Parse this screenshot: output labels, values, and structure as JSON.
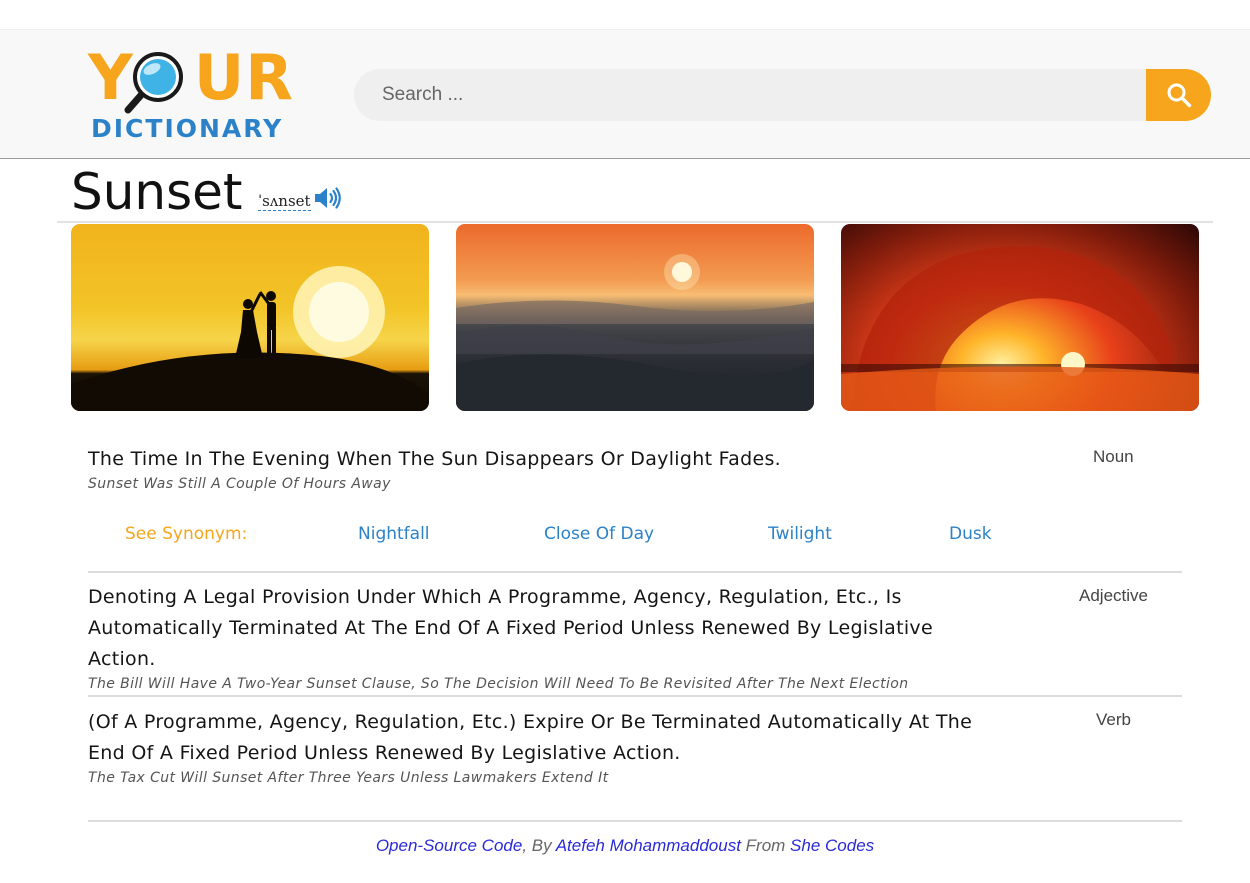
{
  "header": {
    "logo": {
      "line1": "YOUR",
      "line2": "DICTIONARY"
    },
    "search": {
      "placeholder": "Search ...",
      "value": ""
    },
    "search_button_icon": "search-icon"
  },
  "entry": {
    "word": "Sunset",
    "phonetic": "ˈsʌnset",
    "audio_icon": "speaker-icon",
    "images": [
      {
        "subject": "couple silhouette at sunset"
      },
      {
        "subject": "sun over ocean waves"
      },
      {
        "subject": "fiery ocean wave curl"
      }
    ],
    "definitions": [
      {
        "text": "The Time In The Evening When The Sun Disappears Or Daylight Fades.",
        "example": "Sunset Was Still A Couple Of Hours Away",
        "part_of_speech": "Noun"
      },
      {
        "text": "Denoting A Legal Provision Under Which A Programme, Agency, Regulation, Etc., Is Automatically Terminated At The End Of A Fixed Period Unless Renewed By Legislative Action.",
        "example": "The Bill Will Have A Two-Year Sunset Clause, So The Decision Will Need To Be Revisited After The Next Election",
        "part_of_speech": "Adjective"
      },
      {
        "text": "(Of A Programme, Agency, Regulation, Etc.) Expire Or Be Terminated Automatically At The End Of A Fixed Period Unless Renewed By Legislative Action.",
        "example": "The Tax Cut Will Sunset After Three Years Unless Lawmakers Extend It",
        "part_of_speech": "Verb"
      }
    ],
    "synonyms": {
      "label": "See Synonym:",
      "items": [
        "Nightfall",
        "Close Of Day",
        "Twilight",
        "Dusk"
      ]
    }
  },
  "footer": {
    "code_link": "Open-Source Code",
    "by_text": ", By ",
    "author_link": "Atefeh Mohammaddoust",
    "from_text": " From ",
    "org_link": "She Codes"
  },
  "colors": {
    "brand_orange": "#f7a51c",
    "brand_blue": "#2b82c9",
    "footer_link": "#2a2ad9"
  }
}
